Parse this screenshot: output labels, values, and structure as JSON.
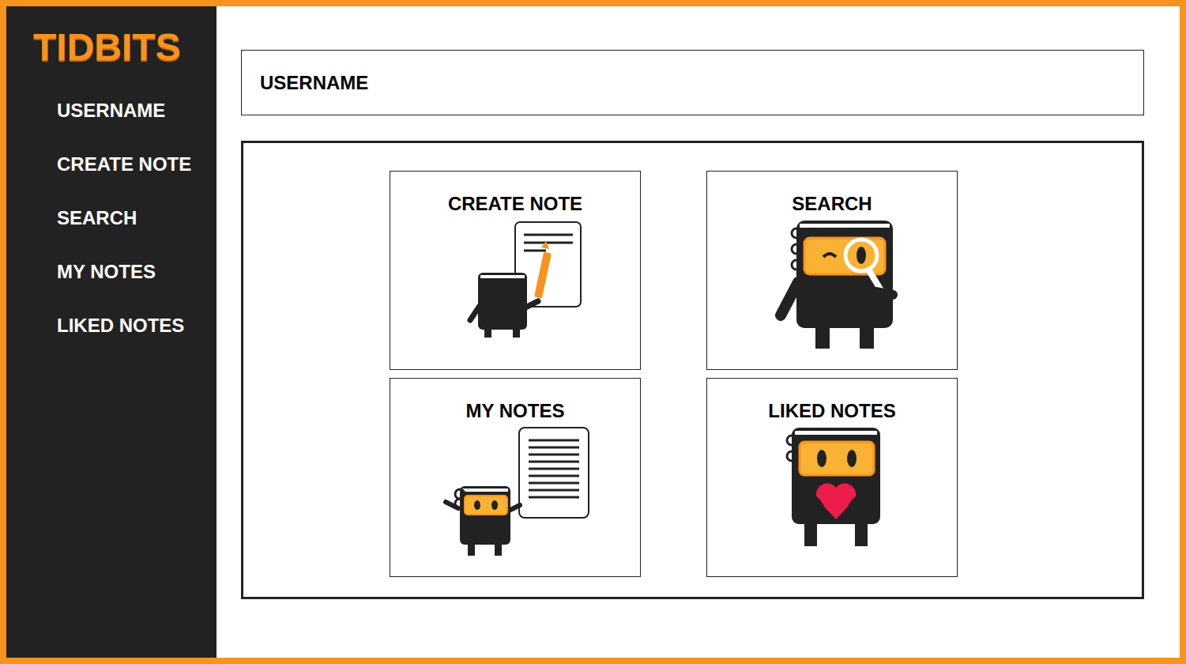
{
  "logo": "TIDBITS",
  "sidebar": {
    "items": [
      {
        "label": "USERNAME"
      },
      {
        "label": "CREATE NOTE"
      },
      {
        "label": "SEARCH"
      },
      {
        "label": "MY NOTES"
      },
      {
        "label": "LIKED NOTES"
      }
    ]
  },
  "header": {
    "username": "USERNAME"
  },
  "cards": [
    {
      "title": "CREATE NOTE",
      "kind": "create"
    },
    {
      "title": "SEARCH",
      "kind": "search"
    },
    {
      "title": "MY NOTES",
      "kind": "mine"
    },
    {
      "title": "LIKED NOTES",
      "kind": "liked"
    }
  ]
}
